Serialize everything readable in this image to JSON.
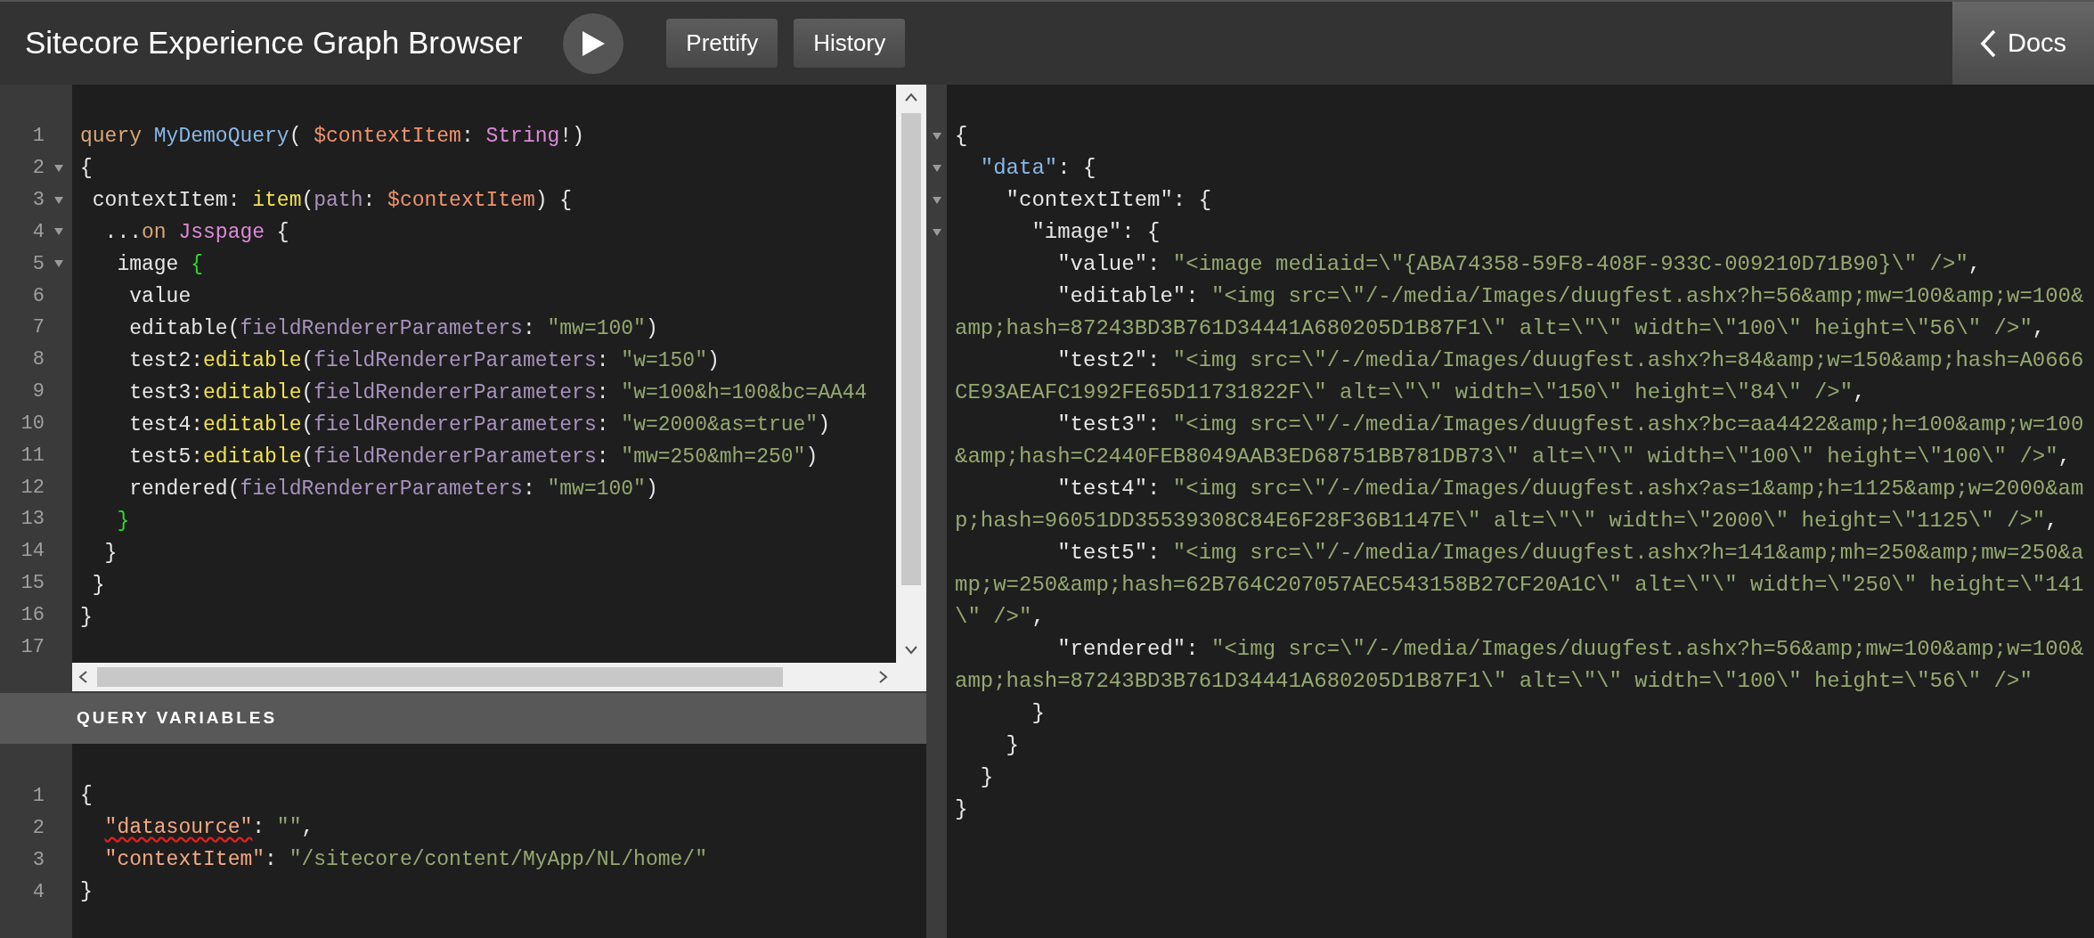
{
  "header": {
    "title": "Sitecore Experience Graph Browser",
    "buttons": [
      "Prettify",
      "History"
    ],
    "docs": "Docs"
  },
  "query_editor": {
    "lines": [
      {
        "number": "1",
        "foldable": false,
        "tokens": [
          {
            "text": "query",
            "kind": "keyword"
          },
          {
            "text": " MyDemoQuery",
            "kind": "def"
          },
          {
            "text": "( ",
            "kind": "plain"
          },
          {
            "text": "$contextItem",
            "kind": "variable"
          },
          {
            "text": ": ",
            "kind": "plain"
          },
          {
            "text": "String",
            "kind": "type"
          },
          {
            "text": "!)",
            "kind": "plain"
          }
        ]
      },
      {
        "number": "2",
        "foldable": true,
        "tokens": [
          {
            "text": "{",
            "kind": "plain"
          }
        ]
      },
      {
        "number": "3",
        "foldable": true,
        "tokens": [
          {
            "text": " contextItem: ",
            "kind": "plain"
          },
          {
            "text": "item",
            "kind": "property"
          },
          {
            "text": "(",
            "kind": "plain"
          },
          {
            "text": "path",
            "kind": "argument"
          },
          {
            "text": ": ",
            "kind": "plain"
          },
          {
            "text": "$contextItem",
            "kind": "variable"
          },
          {
            "text": ") {",
            "kind": "plain"
          }
        ]
      },
      {
        "number": "4",
        "foldable": true,
        "tokens": [
          {
            "text": "  ...",
            "kind": "plain"
          },
          {
            "text": "on",
            "kind": "keyword"
          },
          {
            "text": " Jsspage",
            "kind": "type"
          },
          {
            "text": " {",
            "kind": "plain"
          }
        ]
      },
      {
        "number": "5",
        "foldable": true,
        "tokens": [
          {
            "text": "   image ",
            "kind": "plain"
          },
          {
            "text": "{",
            "kind": "matched"
          }
        ]
      },
      {
        "number": "6",
        "foldable": false,
        "tokens": [
          {
            "text": "    value",
            "kind": "plain"
          }
        ]
      },
      {
        "number": "7",
        "foldable": false,
        "tokens": [
          {
            "text": "    editable(",
            "kind": "plain"
          },
          {
            "text": "fieldRendererParameters",
            "kind": "argument"
          },
          {
            "text": ": ",
            "kind": "plain"
          },
          {
            "text": "\"mw=100\"",
            "kind": "string"
          },
          {
            "text": ")",
            "kind": "plain"
          }
        ]
      },
      {
        "number": "8",
        "foldable": false,
        "tokens": [
          {
            "text": "    test2:",
            "kind": "plain"
          },
          {
            "text": "editable",
            "kind": "property"
          },
          {
            "text": "(",
            "kind": "plain"
          },
          {
            "text": "fieldRendererParameters",
            "kind": "argument"
          },
          {
            "text": ": ",
            "kind": "plain"
          },
          {
            "text": "\"w=150\"",
            "kind": "string"
          },
          {
            "text": ")",
            "kind": "plain"
          }
        ]
      },
      {
        "number": "9",
        "foldable": false,
        "tokens": [
          {
            "text": "    test3:",
            "kind": "plain"
          },
          {
            "text": "editable",
            "kind": "property"
          },
          {
            "text": "(",
            "kind": "plain"
          },
          {
            "text": "fieldRendererParameters",
            "kind": "argument"
          },
          {
            "text": ": ",
            "kind": "plain"
          },
          {
            "text": "\"w=100&h=100&bc=AA44",
            "kind": "string"
          }
        ]
      },
      {
        "number": "10",
        "foldable": false,
        "tokens": [
          {
            "text": "    test4:",
            "kind": "plain"
          },
          {
            "text": "editable",
            "kind": "property"
          },
          {
            "text": "(",
            "kind": "plain"
          },
          {
            "text": "fieldRendererParameters",
            "kind": "argument"
          },
          {
            "text": ": ",
            "kind": "plain"
          },
          {
            "text": "\"w=2000&as=true\"",
            "kind": "string"
          },
          {
            "text": ")",
            "kind": "plain"
          }
        ]
      },
      {
        "number": "11",
        "foldable": false,
        "tokens": [
          {
            "text": "    test5:",
            "kind": "plain"
          },
          {
            "text": "editable",
            "kind": "property"
          },
          {
            "text": "(",
            "kind": "plain"
          },
          {
            "text": "fieldRendererParameters",
            "kind": "argument"
          },
          {
            "text": ": ",
            "kind": "plain"
          },
          {
            "text": "\"mw=250&mh=250\"",
            "kind": "string"
          },
          {
            "text": ")",
            "kind": "plain"
          }
        ]
      },
      {
        "number": "12",
        "foldable": false,
        "tokens": [
          {
            "text": "    rendered(",
            "kind": "plain"
          },
          {
            "text": "fieldRendererParameters",
            "kind": "argument"
          },
          {
            "text": ": ",
            "kind": "plain"
          },
          {
            "text": "\"mw=100\"",
            "kind": "string"
          },
          {
            "text": ")",
            "kind": "plain"
          }
        ]
      },
      {
        "number": "13",
        "foldable": false,
        "tokens": [
          {
            "text": "   }",
            "kind": "matched"
          }
        ]
      },
      {
        "number": "14",
        "foldable": false,
        "tokens": [
          {
            "text": "  }",
            "kind": "plain"
          }
        ]
      },
      {
        "number": "15",
        "foldable": false,
        "tokens": [
          {
            "text": " }",
            "kind": "plain"
          }
        ]
      },
      {
        "number": "16",
        "foldable": false,
        "tokens": [
          {
            "text": "}",
            "kind": "plain"
          }
        ]
      },
      {
        "number": "17",
        "foldable": false
      }
    ]
  },
  "variables_panel": {
    "title": "QUERY VARIABLES",
    "lines": [
      {
        "number": "1",
        "tokens": [
          {
            "text": "{",
            "kind": "plain"
          }
        ]
      },
      {
        "number": "2",
        "tokens": [
          {
            "text": "  \"datasource\"",
            "kind": "attribute",
            "error": true
          },
          {
            "text": ": ",
            "kind": "plain"
          },
          {
            "text": "\"\"",
            "kind": "string"
          },
          {
            "text": ",",
            "kind": "plain"
          }
        ]
      },
      {
        "number": "3",
        "tokens": [
          {
            "text": "  \"contextItem\"",
            "kind": "attribute",
            "error": false
          },
          {
            "text": ": ",
            "kind": "plain"
          },
          {
            "text": "\"/sitecore/content/MyApp/NL/home/\"",
            "kind": "string"
          }
        ]
      },
      {
        "number": "4",
        "tokens": [
          {
            "text": "}",
            "kind": "plain"
          }
        ]
      }
    ]
  },
  "result": {
    "lines": [
      {
        "foldable": true,
        "tokens": [
          {
            "text": "{",
            "kind": "plain"
          }
        ]
      },
      {
        "foldable": true,
        "tokens": [
          {
            "text": "  \"data\"",
            "kind": "def"
          },
          {
            "text": ": {",
            "kind": "plain"
          }
        ]
      },
      {
        "foldable": true,
        "tokens": [
          {
            "text": "    \"contextItem\": {",
            "kind": "plain"
          }
        ]
      },
      {
        "foldable": true,
        "tokens": [
          {
            "text": "      \"image\": {",
            "kind": "plain"
          }
        ]
      },
      {
        "foldable": false,
        "tokens": [
          {
            "text": "        \"value\": ",
            "kind": "plain"
          },
          {
            "text": "\"<image mediaid=\\\"{ABA74358-59F8-408F-933C-009210D71B90}\\\" />\"",
            "kind": "string"
          },
          {
            "text": ",",
            "kind": "plain"
          }
        ]
      },
      {
        "foldable": false,
        "tokens": [
          {
            "text": "        \"editable\": ",
            "kind": "plain"
          },
          {
            "text": "\"<img src=\\\"/-/media/Images/duugfest.ashx?h=56&amp;mw=100&amp;w=100&amp;hash=87243BD3B761D34441A680205D1B87F1\\\" alt=\\\"\\\" width=\\\"100\\\" height=\\\"56\\\" />\"",
            "kind": "string"
          },
          {
            "text": ",",
            "kind": "plain"
          }
        ]
      },
      {
        "foldable": false,
        "tokens": [
          {
            "text": "        \"test2\": ",
            "kind": "plain"
          },
          {
            "text": "\"<img src=\\\"/-/media/Images/duugfest.ashx?h=84&amp;w=150&amp;hash=A0666CE93AEAFC1992FE65D11731822F\\\" alt=\\\"\\\" width=\\\"150\\\" height=\\\"84\\\" />\"",
            "kind": "string"
          },
          {
            "text": ",",
            "kind": "plain"
          }
        ]
      },
      {
        "foldable": false,
        "tokens": [
          {
            "text": "        \"test3\": ",
            "kind": "plain"
          },
          {
            "text": "\"<img src=\\\"/-/media/Images/duugfest.ashx?bc=aa4422&amp;h=100&amp;w=100&amp;hash=C2440FEB8049AAB3ED68751BB781DB73\\\" alt=\\\"\\\" width=\\\"100\\\" height=\\\"100\\\" />\"",
            "kind": "string"
          },
          {
            "text": ",",
            "kind": "plain"
          }
        ]
      },
      {
        "foldable": false,
        "tokens": [
          {
            "text": "        \"test4\": ",
            "kind": "plain"
          },
          {
            "text": "\"<img src=\\\"/-/media/Images/duugfest.ashx?as=1&amp;h=1125&amp;w=2000&amp;hash=96051DD35539308C84E6F28F36B1147E\\\" alt=\\\"\\\" width=\\\"2000\\\" height=\\\"1125\\\" />\"",
            "kind": "string"
          },
          {
            "text": ",",
            "kind": "plain"
          }
        ]
      },
      {
        "foldable": false,
        "tokens": [
          {
            "text": "        \"test5\": ",
            "kind": "plain"
          },
          {
            "text": "\"<img src=\\\"/-/media/Images/duugfest.ashx?h=141&amp;mh=250&amp;mw=250&amp;w=250&amp;hash=62B764C207057AEC543158B27CF20A1C\\\" alt=\\\"\\\" width=\\\"250\\\" height=\\\"141\\\" />\"",
            "kind": "string"
          },
          {
            "text": ",",
            "kind": "plain"
          }
        ]
      },
      {
        "foldable": false,
        "tokens": [
          {
            "text": "        \"rendered\": ",
            "kind": "plain"
          },
          {
            "text": "\"<img src=\\\"/-/media/Images/duugfest.ashx?h=56&amp;mw=100&amp;w=100&amp;hash=87243BD3B761D34441A680205D1B87F1\\\" alt=\\\"\\\" width=\\\"100\\\" height=\\\"56\\\" />\"",
            "kind": "string"
          }
        ]
      },
      {
        "foldable": false,
        "tokens": [
          {
            "text": "      }",
            "kind": "plain"
          }
        ]
      },
      {
        "foldable": false,
        "tokens": [
          {
            "text": "    }",
            "kind": "plain"
          }
        ]
      },
      {
        "foldable": false,
        "tokens": [
          {
            "text": "  }",
            "kind": "plain"
          }
        ]
      },
      {
        "foldable": false,
        "tokens": [
          {
            "text": "}",
            "kind": "plain"
          }
        ]
      }
    ]
  }
}
